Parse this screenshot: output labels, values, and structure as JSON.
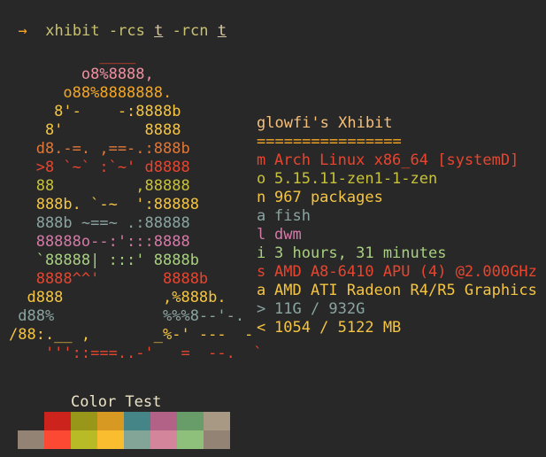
{
  "prompt": {
    "arrow": "→",
    "command": "xhibit -rcs",
    "arg1": "t",
    "flag2": "-rcn",
    "arg2": "t"
  },
  "tux_lines": [
    {
      "text": "          ____",
      "color": "#e8452e"
    },
    {
      "text": "        o8%8888,",
      "color": "#f08fa0"
    },
    {
      "text": "      o88%8888888.",
      "color": "#f5a623"
    },
    {
      "text": "     8'-    -:8888b",
      "color": "#f5c542"
    },
    {
      "text": "    8'         8888",
      "color": "#f5c542"
    },
    {
      "text": "   d8.-=. ,==-.:888b",
      "color": "#e07838"
    },
    {
      "text": "   >8 `~` :`~' d8888",
      "color": "#e8452e"
    },
    {
      "text": "   88         ,88888",
      "color": "#c8c238"
    },
    {
      "text": "   888b. `-~  ':88888",
      "color": "#f5c542"
    },
    {
      "text": "   888b ~==~ .:88888",
      "color": "#8aa4a0"
    },
    {
      "text": "   88888o--:':::8888",
      "color": "#d67aa8"
    },
    {
      "text": "   `88888| :::' 8888b",
      "color": "#a8d080"
    },
    {
      "text": "   8888^^'       8888b",
      "color": "#e8452e"
    },
    {
      "text": "  d888           ,%888b.",
      "color": "#f5c542"
    },
    {
      "text": " d88%            %%%8--'-.",
      "color": "#8aa4a0"
    },
    {
      "text": "/88:.__ ,       _%-' ---  -",
      "color": "#f5c542"
    },
    {
      "text": "    '''::===..-'   =  --.  `",
      "color": "#e8452e"
    }
  ],
  "info": {
    "title": "glowfi's Xhibit",
    "separator": "================",
    "rows": [
      {
        "key": "m",
        "value": "Arch Linux x86_64 [systemD]",
        "color": "#e8452e"
      },
      {
        "key": "o",
        "value": "5.15.11-zen1-1-zen",
        "color": "#c8c238"
      },
      {
        "key": "n",
        "value": "967 packages",
        "color": "#f5c542"
      },
      {
        "key": "a",
        "value": "fish",
        "color": "#8aa4a0"
      },
      {
        "key": "l",
        "value": "dwm",
        "color": "#d67aa8"
      },
      {
        "key": "i",
        "value": "3 hours, 31 minutes",
        "color": "#a8d080"
      },
      {
        "key": "s",
        "value": "AMD A8-6410 APU (4) @2.000GHz",
        "color": "#e8452e"
      },
      {
        "key": "a",
        "value": "AMD ATI Radeon R4/R5 Graphics",
        "color": "#f5c542"
      },
      {
        "key": ">",
        "value": "11G / 932G",
        "color": "#8aa4a0"
      },
      {
        "key": "<",
        "value": "1054 / 5122 MB",
        "color": "#f5c542"
      }
    ]
  },
  "color_test": {
    "title": "Color Test",
    "row1": [
      "#282828",
      "#cc241d",
      "#98971a",
      "#d79921",
      "#458588",
      "#b16286",
      "#689d6a",
      "#a89984"
    ],
    "row2": [
      "#928374",
      "#fb4934",
      "#b8bb26",
      "#fabd2f",
      "#83a598",
      "#d3869b",
      "#8ec07c",
      "#928374"
    ]
  }
}
